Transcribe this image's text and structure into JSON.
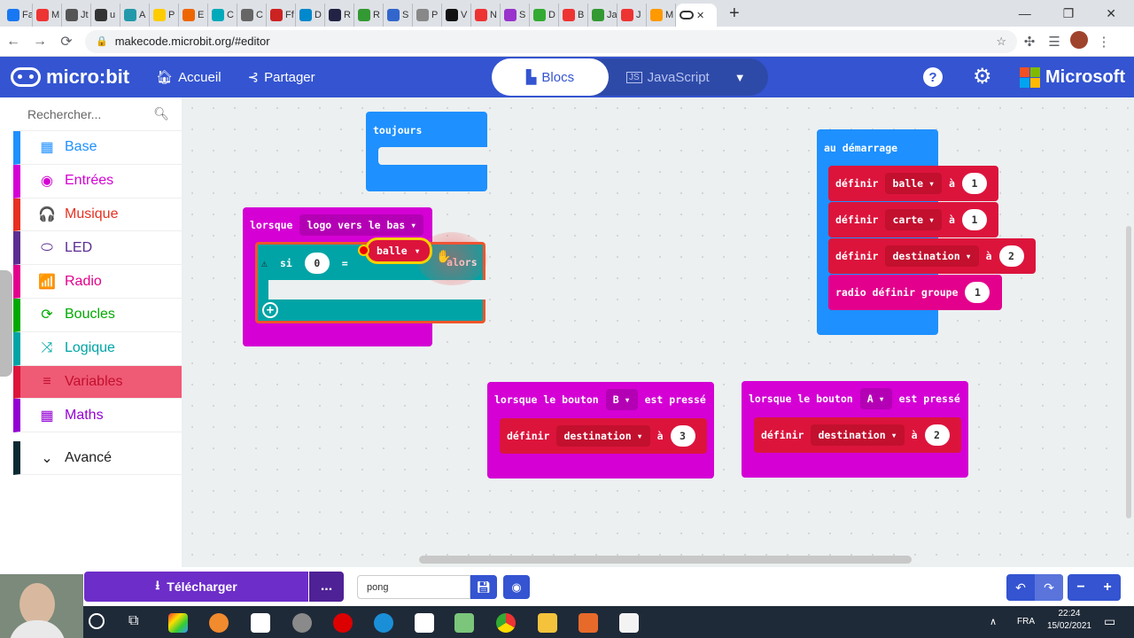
{
  "browser": {
    "tabs": [
      "Fa",
      "M",
      "Jt",
      "u",
      "A",
      "P",
      "E",
      "C",
      "C",
      "Ff",
      "D",
      "R",
      "R",
      "S",
      "P",
      "V",
      "N",
      "S",
      "D",
      "B",
      "Ja",
      "J",
      "M"
    ],
    "active_tab_label": "",
    "url": "makecode.microbit.org/#editor",
    "nav": {
      "back": "←",
      "forward": "→",
      "reload": "⟳",
      "new_tab": "+"
    }
  },
  "header": {
    "logo_text": "micro:bit",
    "home_label": "Accueil",
    "share_label": "Partager",
    "blocks_label": "Blocs",
    "javascript_label": "JavaScript",
    "microsoft_label": "Microsoft"
  },
  "toolbox": {
    "search_placeholder": "Rechercher...",
    "categories": [
      {
        "label": "Base",
        "color": "#1e90ff",
        "icon": "▦"
      },
      {
        "label": "Entrées",
        "color": "#d400d4",
        "icon": "◉"
      },
      {
        "label": "Musique",
        "color": "#e63022",
        "icon": "🎧"
      },
      {
        "label": "LED",
        "color": "#5c2d91",
        "icon": "⬭"
      },
      {
        "label": "Radio",
        "color": "#e3008c",
        "icon": "📶"
      },
      {
        "label": "Boucles",
        "color": "#00aa00",
        "icon": "⟳"
      },
      {
        "label": "Logique",
        "color": "#00a4a6",
        "icon": "⤨"
      },
      {
        "label": "Variables",
        "color": "#dc143c",
        "icon": "≡"
      },
      {
        "label": "Maths",
        "color": "#9400d3",
        "icon": "▦"
      }
    ],
    "advanced_label": "Avancé"
  },
  "blocks": {
    "forever": "toujours",
    "on_start": "au démarrage",
    "gesture_event": "lorsque",
    "gesture_value": "logo vers le bas",
    "if_label": "si",
    "then_label": "alors",
    "compare_left": "0",
    "compare_op": "=",
    "compare_var": "balle",
    "set_label": "définir",
    "to_label": "à",
    "set1_var": "balle",
    "set1_val": "1",
    "set2_var": "carte",
    "set2_val": "1",
    "set3_var": "destination",
    "set3_val": "2",
    "radio_group": "radio définir groupe",
    "radio_group_val": "1",
    "button_event_a": "lorsque le bouton",
    "button_event_b": "est pressé",
    "btnB": "B",
    "btnA": "A",
    "setB_var": "destination",
    "setB_val": "3",
    "setA_var": "destination",
    "setA_val": "2"
  },
  "bottom": {
    "download_label": "Télécharger",
    "more_label": "...",
    "project_name": "pong"
  },
  "taskbar": {
    "lang": "FRA",
    "time": "22:24",
    "date": "15/02/2021"
  }
}
